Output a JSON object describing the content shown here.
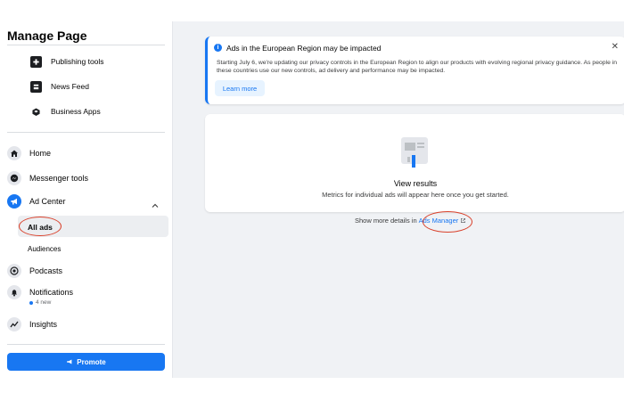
{
  "sidebar": {
    "title": "Manage Page",
    "sub_items": [
      {
        "label": "Publishing tools",
        "icon": "publishing-tools-icon"
      },
      {
        "label": "News Feed",
        "icon": "news-feed-icon"
      },
      {
        "label": "Business Apps",
        "icon": "business-apps-icon"
      }
    ],
    "nav": {
      "home": "Home",
      "messenger_tools": "Messenger tools",
      "ad_center": "Ad Center",
      "all_ads": "All ads",
      "audiences": "Audiences",
      "podcasts": "Podcasts",
      "notifications": "Notifications",
      "notifications_count": "4 new",
      "insights": "Insights"
    },
    "promote_label": "Promote"
  },
  "alert": {
    "title": "Ads in the European Region may be impacted",
    "body": "Starting July 6, we're updating our privacy controls in the European Region to align our products with evolving regional privacy guidance. As people in these countries use our new controls, ad delivery and performance may be impacted.",
    "learn_more": "Learn more"
  },
  "results": {
    "title": "View results",
    "description": "Metrics for individual ads will appear here once you get started."
  },
  "more_details": {
    "prefix": "Show more details in",
    "link": "Ads Manager"
  },
  "colors": {
    "accent": "#1877f2",
    "annotation": "#d9412b"
  }
}
